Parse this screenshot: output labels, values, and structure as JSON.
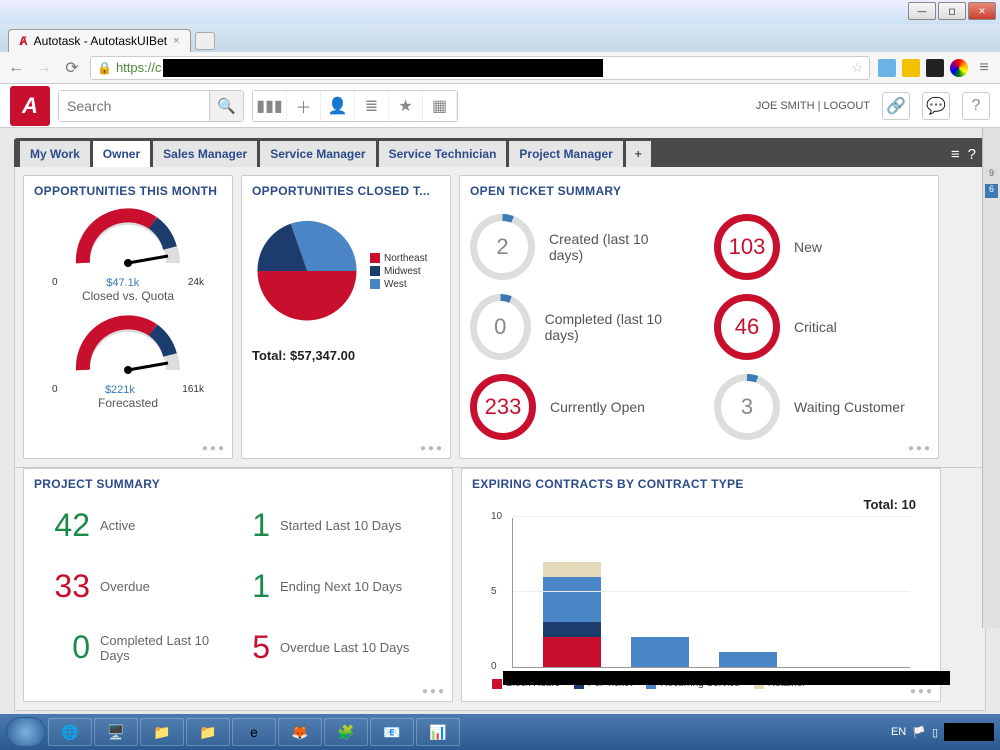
{
  "window": {
    "title": "Autotask - AutotaskUIBeta"
  },
  "browser": {
    "tab_title": "Autotask - AutotaskUIBet",
    "url_prefix": "https://c"
  },
  "header": {
    "search_placeholder": "Search",
    "user_name": "JOE SMITH",
    "logout": "LOGOUT"
  },
  "tabs": [
    "My Work",
    "Owner",
    "Sales Manager",
    "Service Manager",
    "Service Technician",
    "Project Manager"
  ],
  "active_tab": 1,
  "widgets": {
    "opps_month": {
      "title": "OPPORTUNITIES THIS MONTH",
      "gauge1": {
        "min": "0",
        "max": "24k",
        "value": "$47.1k",
        "label": "Closed vs. Quota"
      },
      "gauge2": {
        "min": "0",
        "max": "161k",
        "value": "$221k",
        "label": "Forecasted"
      }
    },
    "opps_closed": {
      "title": "OPPORTUNITIES CLOSED T...",
      "legend": [
        {
          "label": "Northeast",
          "color": "#c8102e"
        },
        {
          "label": "Midwest",
          "color": "#1d3c6e"
        },
        {
          "label": "West",
          "color": "#4a86c6"
        }
      ],
      "total_label": "Total:  $57,347.00"
    },
    "tickets": {
      "title": "OPEN TICKET SUMMARY",
      "items": [
        {
          "value": "2",
          "label": "Created (last 10 days)",
          "style": "grey"
        },
        {
          "value": "103",
          "label": "New",
          "style": "red"
        },
        {
          "value": "0",
          "label": "Completed (last 10 days)",
          "style": "grey"
        },
        {
          "value": "46",
          "label": "Critical",
          "style": "red"
        },
        {
          "value": "233",
          "label": "Currently Open",
          "style": "red"
        },
        {
          "value": "3",
          "label": "Waiting Customer",
          "style": "grey"
        }
      ]
    },
    "projects": {
      "title": "PROJECT SUMMARY",
      "rows": [
        {
          "num": "42",
          "color": "green",
          "label": "Active",
          "num2": "1",
          "color2": "green",
          "label2": "Started Last 10 Days"
        },
        {
          "num": "33",
          "color": "red",
          "label": "Overdue",
          "num2": "1",
          "color2": "green",
          "label2": "Ending Next 10 Days"
        },
        {
          "num": "0",
          "color": "green",
          "label": "Completed Last 10 Days",
          "num2": "5",
          "color2": "red",
          "label2": "Overdue Last 10 Days"
        }
      ]
    },
    "contracts": {
      "title": "EXPIRING CONTRACTS BY CONTRACT TYPE",
      "total_label": "Total:  10",
      "legend": [
        "Block Hours",
        "Per Ticket",
        "Recurring Service",
        "Retainer"
      ]
    }
  },
  "taskbar": {
    "lang": "EN"
  },
  "rgutter": {
    "top": "9",
    "bottom": "6"
  },
  "chart_data": [
    {
      "type": "pie",
      "title": "Opportunities Closed (Total $57,347.00)",
      "series": [
        {
          "name": "Northeast",
          "value": 40,
          "color": "#c8102e"
        },
        {
          "name": "Midwest",
          "value": 25,
          "color": "#1d3c6e"
        },
        {
          "name": "West",
          "value": 35,
          "color": "#4a86c6"
        }
      ]
    },
    {
      "type": "bar",
      "title": "Expiring Contracts by Contract Type",
      "ylabel": "",
      "ylim": [
        0,
        10
      ],
      "yticks": [
        0,
        5,
        10
      ],
      "categories": [
        "(redacted 1)",
        "(redacted 2)",
        "(redacted 3)"
      ],
      "stack_order": [
        "Block Hours",
        "Per Ticket",
        "Recurring Service",
        "Retainer"
      ],
      "colors": {
        "Block Hours": "#c8102e",
        "Per Ticket": "#1d3c6e",
        "Recurring Service": "#4a86c6",
        "Retainer": "#e4d9b9"
      },
      "series": [
        {
          "name": "Block Hours",
          "values": [
            2,
            0,
            0
          ]
        },
        {
          "name": "Per Ticket",
          "values": [
            1,
            0,
            0
          ]
        },
        {
          "name": "Recurring Service",
          "values": [
            3,
            2,
            1
          ]
        },
        {
          "name": "Retainer",
          "values": [
            1,
            0,
            0
          ]
        }
      ],
      "total": 10
    }
  ]
}
